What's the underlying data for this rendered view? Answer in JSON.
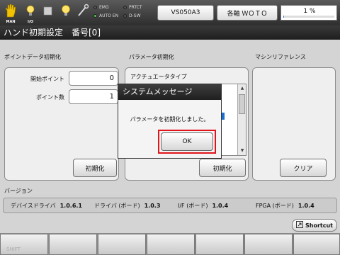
{
  "toolbar": {
    "icons": [
      {
        "name": "hand-icon",
        "caption": "MAN"
      },
      {
        "name": "lightbulb-icon",
        "caption": ""
      },
      {
        "name": "io-icon",
        "caption": "I/O"
      },
      {
        "name": "stop-icon",
        "caption": ""
      },
      {
        "name": "lamp-icon",
        "caption": ""
      },
      {
        "name": "wrench-icon",
        "caption": ""
      }
    ],
    "status": {
      "emg": "EMG",
      "prtct": "PRTCT",
      "auto_en": "AUTO EN",
      "dsw": "D-SW"
    },
    "program": "VS050A3",
    "axis": "各軸 ＷＯＴＯ",
    "speed": "1 %",
    "speed_fraction": 0.01
  },
  "page": {
    "title": "ハンド初期設定　番号[0]"
  },
  "point_data": {
    "heading": "ポイントデータ初期化",
    "start_label": "開始ポイント",
    "start_value": "0",
    "count_label": "ポイント数",
    "count_value": "1",
    "init_button": "初期化"
  },
  "param": {
    "heading": "パラメータ初期化",
    "list_header": "アクチュエータタイプ",
    "init_button": "初期化"
  },
  "machine_ref": {
    "heading": "マシンリファレンス",
    "clear_button": "クリア"
  },
  "version": {
    "heading": "バージョン",
    "items": [
      {
        "label": "デバイスドライバ",
        "value": "1.0.6.1"
      },
      {
        "label": "ドライバ (ボード)",
        "value": "1.0.3"
      },
      {
        "label": "I/F (ボード)",
        "value": "1.0.4"
      },
      {
        "label": "FPGA (ボード)",
        "value": "1.0.4"
      }
    ]
  },
  "shortcut_label": "Shortcut",
  "fkeys": [
    "SHIFT",
    "",
    "",
    "",
    "",
    "",
    ""
  ],
  "dialog": {
    "title": "システムメッセージ",
    "message": "パラメータを初期化しました。",
    "ok": "OK"
  }
}
